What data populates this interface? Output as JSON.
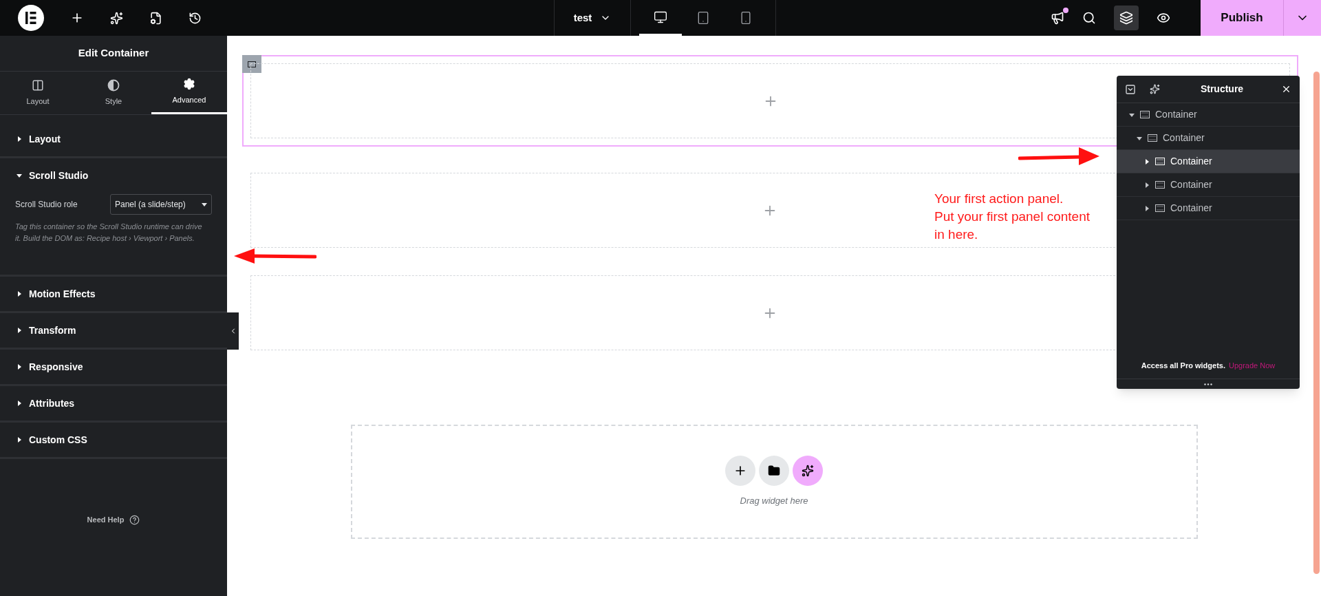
{
  "topbar": {
    "page_title": "test",
    "devices": [
      {
        "kind": "desktop",
        "selected": true
      },
      {
        "kind": "tablet",
        "selected": false
      },
      {
        "kind": "mobile",
        "selected": false
      }
    ],
    "notification": true,
    "structure_active": true,
    "publish": "Publish"
  },
  "panel": {
    "title": "Edit Container",
    "tabs": [
      {
        "kind": "layout",
        "label": "Layout",
        "selected": false
      },
      {
        "kind": "style",
        "label": "Style",
        "selected": false
      },
      {
        "kind": "advanced",
        "label": "Advanced",
        "selected": true
      }
    ],
    "sections": [
      {
        "label": "Layout",
        "expanded": false
      },
      {
        "label": "Scroll Studio",
        "expanded": true,
        "field": {
          "label": "Scroll Studio role",
          "value": "Panel (a slide/step)"
        },
        "help": "Tag this container so the Scroll Studio runtime can drive it. Build the DOM as: Recipe host › Viewport › Panels."
      },
      {
        "label": "Motion Effects",
        "expanded": false
      },
      {
        "label": "Transform",
        "expanded": false
      },
      {
        "label": "Responsive",
        "expanded": false
      },
      {
        "label": "Attributes",
        "expanded": false
      },
      {
        "label": "Custom CSS",
        "expanded": false
      }
    ],
    "need_help": "Need Help"
  },
  "canvas": {
    "containers": [
      {
        "selected": true
      },
      {
        "selected": false,
        "annotation": [
          "Your first action panel.",
          "Put your first panel content",
          "in here."
        ]
      },
      {
        "selected": false
      }
    ],
    "drop_zone": {
      "hint": "Drag widget here"
    }
  },
  "structure": {
    "title": "Structure",
    "tree": [
      {
        "label": "Container",
        "expanded": true,
        "selected": false,
        "children": [
          {
            "label": "Container",
            "expanded": true,
            "selected": false,
            "children": [
              {
                "label": "Container",
                "expanded": false,
                "selected": true
              },
              {
                "label": "Container",
                "expanded": false,
                "selected": false
              },
              {
                "label": "Container",
                "expanded": false,
                "selected": false
              }
            ]
          }
        ]
      }
    ],
    "promo": "Access all Pro widgets.",
    "link": "Upgrade Now"
  }
}
